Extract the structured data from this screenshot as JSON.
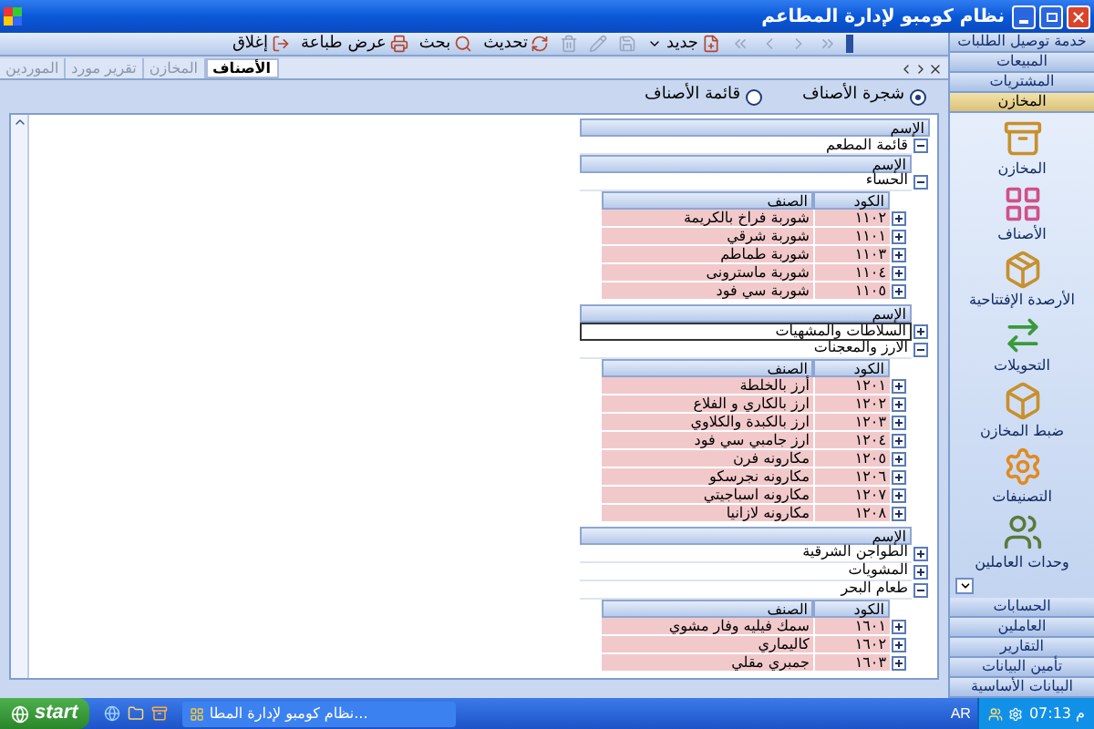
{
  "window": {
    "title": "نظام كومبو لإدارة المطاعم"
  },
  "toolbar": [
    {
      "kind": "first",
      "disabled": true
    },
    {
      "kind": "prev",
      "disabled": true
    },
    {
      "kind": "next",
      "disabled": true
    },
    {
      "kind": "last",
      "disabled": true
    },
    {
      "kind": "new",
      "label": "جديد",
      "disabled": false,
      "dropdown": true
    },
    {
      "kind": "save",
      "disabled": true
    },
    {
      "kind": "edit",
      "disabled": true
    },
    {
      "kind": "delete",
      "disabled": true
    },
    {
      "kind": "refresh",
      "label": "تحديث",
      "disabled": false
    },
    {
      "kind": "search",
      "label": "بحث",
      "disabled": false
    },
    {
      "kind": "preview",
      "label": "عرض طباعة",
      "disabled": false
    },
    {
      "kind": "exit",
      "label": "إغلاق",
      "disabled": false
    }
  ],
  "tabs": [
    {
      "label": "الأصناف",
      "selected": true
    },
    {
      "label": "المخازن",
      "selected": false
    },
    {
      "label": "تقرير مورد",
      "selected": false
    },
    {
      "label": "الموردين",
      "selected": false
    }
  ],
  "view_options": [
    {
      "label": "شجرة الأصناف",
      "selected": true
    },
    {
      "label": "قائمة الأصناف",
      "selected": false
    }
  ],
  "tree": {
    "header": "الإسم",
    "rows": [
      {
        "name": "قائمة المطعم",
        "expanded": true,
        "groups": [
          {
            "header": "الإسم",
            "rows": [
              {
                "name": "الحساء",
                "expanded": true,
                "selected": false,
                "columns": [
                  "الكود",
                  "الصنف"
                ],
                "items": [
                  {
                    "code": "١١٠٢",
                    "name": "شوربة فراخ بالكريمة",
                    "expanded": false
                  },
                  {
                    "code": "١١٠١",
                    "name": "شوربة شرقي",
                    "expanded": false
                  },
                  {
                    "code": "١١٠٣",
                    "name": "شوربة طماطم",
                    "expanded": false
                  },
                  {
                    "code": "١١٠٤",
                    "name": "شوربة ماسترونى",
                    "expanded": false
                  },
                  {
                    "code": "١١٠٥",
                    "name": "شوربة سي فود",
                    "expanded": false
                  }
                ]
              }
            ]
          },
          {
            "header": "الإسم",
            "rows": [
              {
                "name": "السلاطات والمشهيات",
                "expanded": false,
                "selected": true
              },
              {
                "name": "الارز والمعجنات",
                "expanded": true,
                "selected": false,
                "columns": [
                  "الكود",
                  "الصنف"
                ],
                "items": [
                  {
                    "code": "١٢٠١",
                    "name": "أرز بالخلطة",
                    "expanded": false
                  },
                  {
                    "code": "١٢٠٢",
                    "name": "ارز بالكاري و الفلاع",
                    "expanded": false
                  },
                  {
                    "code": "١٢٠٣",
                    "name": "ارز بالكبدة والكلاوي",
                    "expanded": false
                  },
                  {
                    "code": "١٢٠٤",
                    "name": "ارز جامبي سي فود",
                    "expanded": false
                  },
                  {
                    "code": "١٢٠٥",
                    "name": "مكارونه فرن",
                    "expanded": false
                  },
                  {
                    "code": "١٢٠٦",
                    "name": "مكارونه نجرسكو",
                    "expanded": false
                  },
                  {
                    "code": "١٢٠٧",
                    "name": "مكارونه اسباجيتي",
                    "expanded": false
                  },
                  {
                    "code": "١٢٠٨",
                    "name": "مكارونه لازانيا",
                    "expanded": false
                  }
                ]
              }
            ]
          },
          {
            "header": "الإسم",
            "rows": [
              {
                "name": "الطواجن الشرقية",
                "expanded": false,
                "selected": false
              },
              {
                "name": "المشويات",
                "expanded": false,
                "selected": false
              },
              {
                "name": "طعام البحر",
                "expanded": true,
                "selected": false,
                "columns": [
                  "الكود",
                  "الصنف"
                ],
                "items": [
                  {
                    "code": "١٦٠١",
                    "name": "سمك فيليه وفار مشوي",
                    "expanded": false
                  },
                  {
                    "code": "١٦٠٢",
                    "name": "كاليماري",
                    "expanded": false
                  },
                  {
                    "code": "١٦٠٣",
                    "name": "جمبري مقلي",
                    "expanded": false
                  }
                ]
              }
            ]
          }
        ]
      }
    ]
  },
  "sidebar": {
    "top_groups": [
      {
        "label": "خدمة توصيل الطلبات",
        "selected": false
      },
      {
        "label": "المبيعات",
        "selected": false
      },
      {
        "label": "المشتريات",
        "selected": false
      },
      {
        "label": "المخازن",
        "selected": true
      }
    ],
    "tools": [
      {
        "kind": "store",
        "label": "المخازن"
      },
      {
        "kind": "items",
        "label": "الأصناف"
      },
      {
        "kind": "balance",
        "label": "الأرصدة الإفتتاحية"
      },
      {
        "kind": "transfer",
        "label": "التحويلات"
      },
      {
        "kind": "adjust",
        "label": "ضبط المخازن"
      },
      {
        "kind": "categories",
        "label": "التصنيفات"
      },
      {
        "kind": "units",
        "label": "وحدات العاملين"
      }
    ],
    "bottom_groups": [
      {
        "label": "الحسابات",
        "selected": false
      },
      {
        "label": "العاملين",
        "selected": false
      },
      {
        "label": "التقارير",
        "selected": false
      },
      {
        "label": "تأمين البيانات",
        "selected": false
      },
      {
        "label": "البيانات الأساسية",
        "selected": false
      }
    ]
  },
  "taskbar": {
    "start": "start",
    "task": "نظام كومبو لإدارة المطا...",
    "language": "AR",
    "clock": "07:13 م"
  }
}
